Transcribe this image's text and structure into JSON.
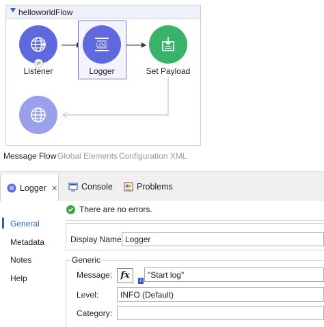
{
  "flow": {
    "name": "helloworldFlow",
    "nodes": [
      {
        "id": "listener",
        "label": "Listener",
        "color": "#6068dd",
        "icon": "globe-icon"
      },
      {
        "id": "logger",
        "label": "Logger",
        "color": "#6068dd",
        "icon": "log-icon",
        "icon_text": "LOG"
      },
      {
        "id": "set_payload",
        "label": "Set Payload",
        "color": "#3ab36a",
        "icon": "set-payload-icon"
      },
      {
        "id": "response",
        "label": "",
        "color": "#9aa0ec",
        "icon": "globe-icon"
      }
    ]
  },
  "editor_tabs": [
    "Message Flow",
    "Global Elements",
    "Configuration XML"
  ],
  "panel_tabs": {
    "active": "Logger",
    "console": "Console",
    "problems": "Problems"
  },
  "side_nav": [
    "General",
    "Metadata",
    "Notes",
    "Help"
  ],
  "status": "There are no errors.",
  "form": {
    "display_name_label": "Display Name:",
    "display_name_value": "Logger",
    "generic_legend": "Generic",
    "message_label": "Message:",
    "fx_label": "fx",
    "message_value": "\"Start log\"",
    "level_label": "Level:",
    "level_value": "INFO (Default)",
    "category_label": "Category:",
    "category_value": ""
  },
  "colors": {
    "accent": "#2e5fbe",
    "node_blue": "#6068dd",
    "node_green": "#3ab36a",
    "node_light": "#9aa0ec",
    "success": "#3da344"
  }
}
